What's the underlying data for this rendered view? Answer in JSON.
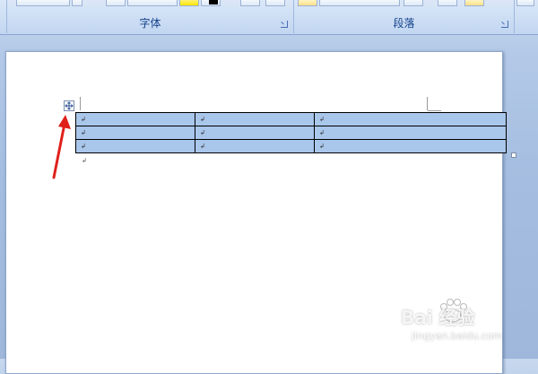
{
  "ribbon": {
    "groups": [
      {
        "label": "字体"
      },
      {
        "label": "段落"
      }
    ]
  },
  "document": {
    "table": {
      "rows": [
        [
          "↲",
          "↲",
          "↲"
        ],
        [
          "↲",
          "↲",
          "↲"
        ],
        [
          "↲",
          "↲",
          "↲"
        ]
      ],
      "fill_color": "#a9c6eb"
    },
    "paragraph_mark": "↲"
  },
  "icons": {
    "table_move": "move-arrows-icon",
    "table_resize": "square-handle-icon",
    "annotation": "red-arrow-icon"
  },
  "watermark": {
    "brand": "Bai 经验",
    "url": "jingyan.baidu.com"
  }
}
